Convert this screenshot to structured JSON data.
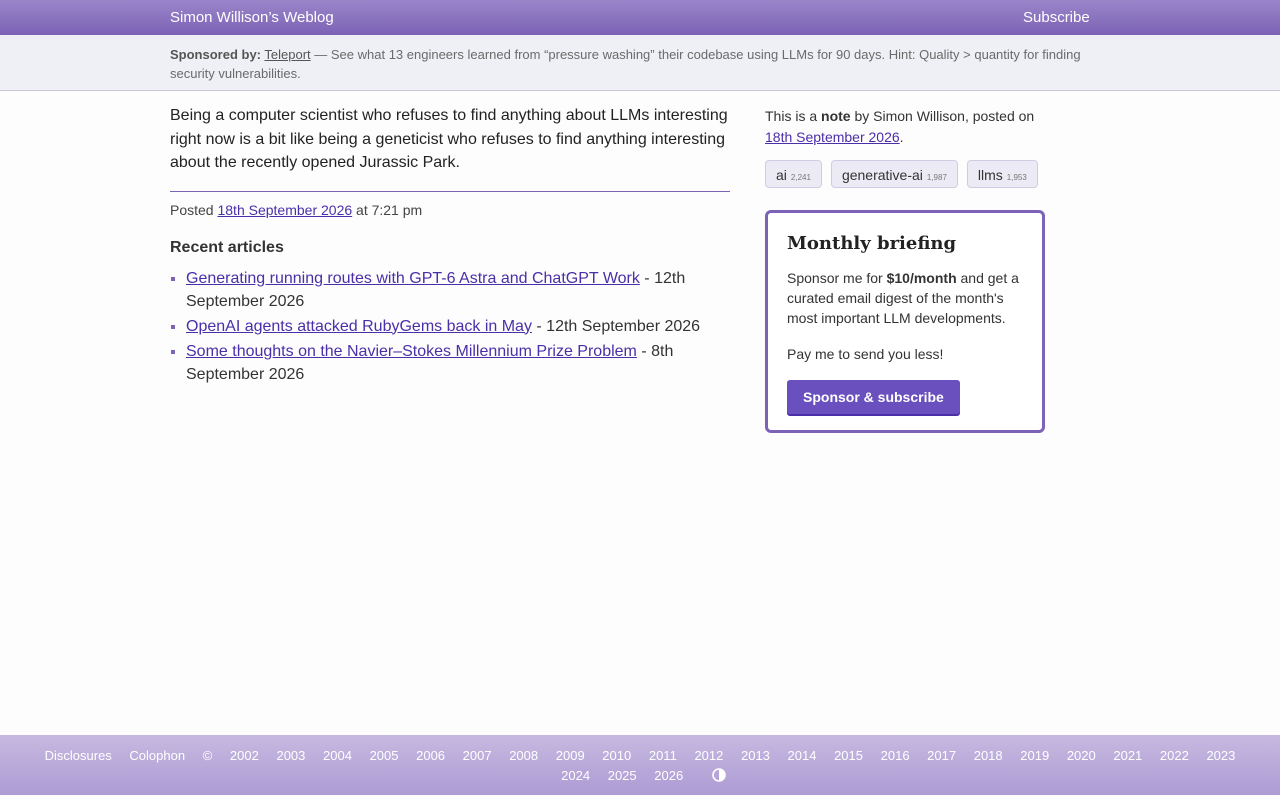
{
  "header": {
    "site_title": "Simon Willison’s Weblog",
    "subscribe": "Subscribe"
  },
  "sponsor": {
    "label": "Sponsored by:",
    "name": "Teleport",
    "text": " — See what 13 engineers learned from “pressure washing” their codebase using LLMs for 90 days. Hint: Quality > quantity for finding security vulnerabilities."
  },
  "note": {
    "body": "Being a computer scientist who refuses to find anything about LLMs interesting right now is a bit like being a geneticist who refuses to find anything interesting about the recently opened Jurassic Park.",
    "posted_prefix": "Posted",
    "posted_date": "18th September 2026",
    "posted_time": "at 7:21 pm"
  },
  "recent": {
    "heading": "Recent articles",
    "items": [
      {
        "title": "Generating running routes with GPT-6 Astra and ChatGPT Work",
        "date": " - 12th September 2026"
      },
      {
        "title": "OpenAI agents attacked RubyGems back in May",
        "date": " - 12th September 2026"
      },
      {
        "title": "Some thoughts on the Navier–Stokes Millennium Prize Problem",
        "date": " - 8th September 2026"
      }
    ]
  },
  "sidebar": {
    "meta_prefix": "This is a ",
    "meta_type": "note",
    "meta_by": " by Simon Willison, posted on ",
    "meta_date": "18th September 2026",
    "meta_end": ".",
    "tags": [
      {
        "name": "ai",
        "count": "2,241"
      },
      {
        "name": "generative-ai",
        "count": "1,987"
      },
      {
        "name": "llms",
        "count": "1,953"
      }
    ]
  },
  "briefing": {
    "title": "Monthly briefing",
    "text_pre": "Sponsor me for ",
    "price": "$10/month",
    "text_post": " and get a curated email digest of the month's most important LLM developments.",
    "less": "Pay me to send you less!",
    "button": "Sponsor & subscribe"
  },
  "footer": {
    "disclosures": "Disclosures",
    "colophon": "Colophon",
    "copyright": "©",
    "years": [
      "2002",
      "2003",
      "2004",
      "2005",
      "2006",
      "2007",
      "2008",
      "2009",
      "2010",
      "2011",
      "2012",
      "2013",
      "2014",
      "2015",
      "2016",
      "2017",
      "2018",
      "2019",
      "2020",
      "2021",
      "2022",
      "2023",
      "2024",
      "2025",
      "2026"
    ],
    "contrast_icon": "contrast-icon"
  },
  "colors": {
    "accent": "#7d63b6",
    "link": "#4b2fa8",
    "button": "#6a4fbf"
  }
}
